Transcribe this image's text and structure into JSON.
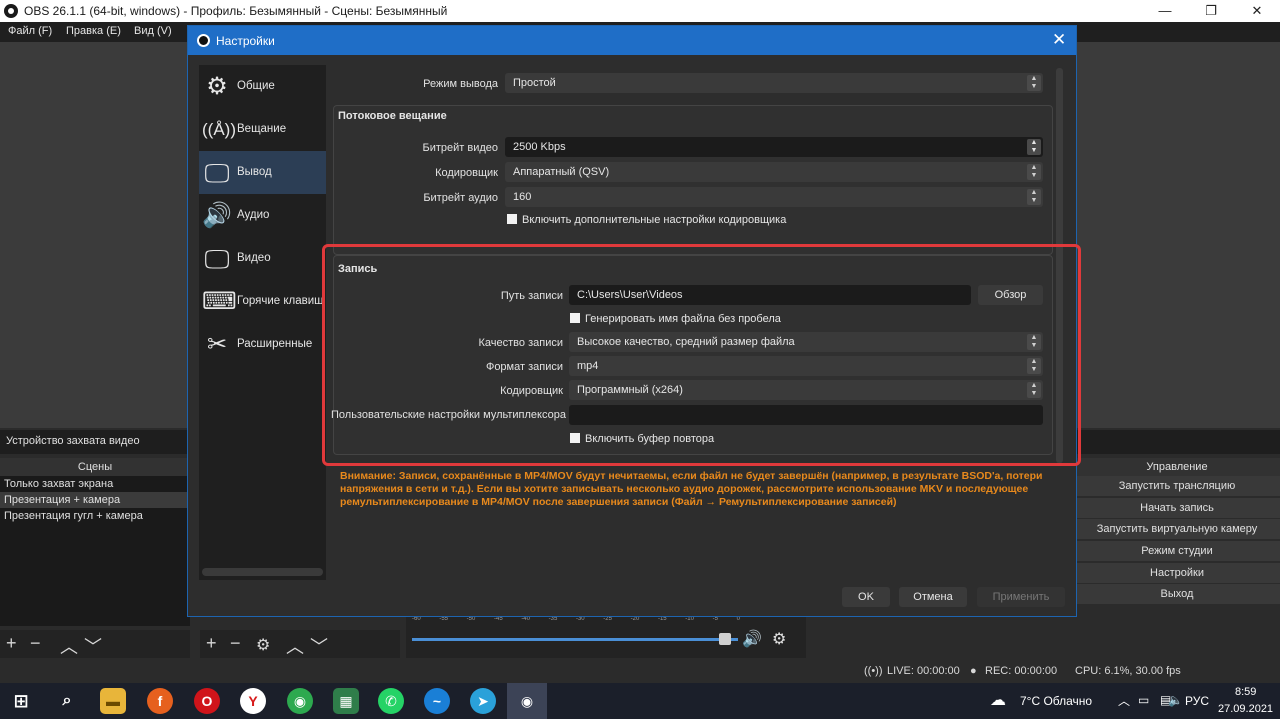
{
  "window": {
    "title": "OBS 26.1.1 (64-bit, windows) - Профиль: Безымянный - Сцены: Безымянный",
    "minimize": "—",
    "maximize": "❐",
    "close": "✕"
  },
  "menu": [
    "Файл (F)",
    "Правка (E)",
    "Вид (V)"
  ],
  "source_bar": "Устройство захвата видео",
  "scenes": {
    "header": "Сцены",
    "items": [
      "Только захват экрана",
      "Презентация + камера",
      "Презентация гугл + камера"
    ],
    "selected_index": 1
  },
  "controls": {
    "header": "Управление",
    "buttons": [
      "Запустить трансляцию",
      "Начать запись",
      "Запустить виртуальную камеру",
      "Режим студии",
      "Настройки",
      "Выход"
    ]
  },
  "mixer": {
    "scale": [
      "-60",
      "-55",
      "-50",
      "-45",
      "-40",
      "-35",
      "-30",
      "-25",
      "-20",
      "-15",
      "-10",
      "-5",
      "0"
    ],
    "volume_level": 0.96
  },
  "status": {
    "live": "LIVE: 00:00:00",
    "rec": "REC: 00:00:00",
    "cpu": "CPU: 6.1%, 30.00 fps"
  },
  "dialog": {
    "title": "Настройки",
    "close": "✕",
    "nav": [
      {
        "label": "Общие",
        "icon": "gear-icon"
      },
      {
        "label": "Вещание",
        "icon": "antenna-icon"
      },
      {
        "label": "Вывод",
        "icon": "monitor-output-icon"
      },
      {
        "label": "Аудио",
        "icon": "speaker-icon"
      },
      {
        "label": "Видео",
        "icon": "monitor-icon"
      },
      {
        "label": "Горячие клавиши",
        "icon": "keyboard-icon"
      },
      {
        "label": "Расширенные",
        "icon": "tools-icon"
      }
    ],
    "selected_nav": 2,
    "output_mode": {
      "label": "Режим вывода",
      "value": "Простой"
    },
    "streaming": {
      "title": "Потоковое вещание",
      "video_bitrate": {
        "label": "Битрейт видео",
        "value": "2500 Kbps"
      },
      "encoder": {
        "label": "Кодировщик",
        "value": "Аппаратный (QSV)"
      },
      "audio_bitrate": {
        "label": "Битрейт аудио",
        "value": "160"
      },
      "advanced_checkbox": "Включить дополнительные настройки кодировщика"
    },
    "recording": {
      "title": "Запись",
      "path": {
        "label": "Путь записи",
        "value": "C:\\Users\\User\\Videos",
        "browse": "Обзор"
      },
      "no_space_checkbox": "Генерировать имя файла без пробела",
      "quality": {
        "label": "Качество записи",
        "value": "Высокое качество, средний размер файла"
      },
      "format": {
        "label": "Формат записи",
        "value": "mp4"
      },
      "encoder": {
        "label": "Кодировщик",
        "value": "Программный (x264)"
      },
      "muxer": {
        "label": "Пользовательские настройки мультиплексора",
        "value": ""
      },
      "replay_checkbox": "Включить буфер повтора"
    },
    "warning": "Внимание: Записи, сохранённые в MP4/MOV будут нечитаемы, если файл не будет завершён (например, в результате BSOD'а, потери напряжения в сети и т.д.). Если вы хотите записывать несколько аудио дорожек, рассмотрите использование MKV и последующее ремультиплексирование в MP4/MOV после завершения записи (Файл → Ремультиплексирование записей)",
    "buttons": {
      "ok": "OK",
      "cancel": "Отмена",
      "apply": "Применить"
    },
    "highlight_color": "#e0393b"
  },
  "taskbar": {
    "weather": "7°C  Облачно",
    "lang": "РУС",
    "time": "8:59",
    "date": "27.09.2021"
  }
}
